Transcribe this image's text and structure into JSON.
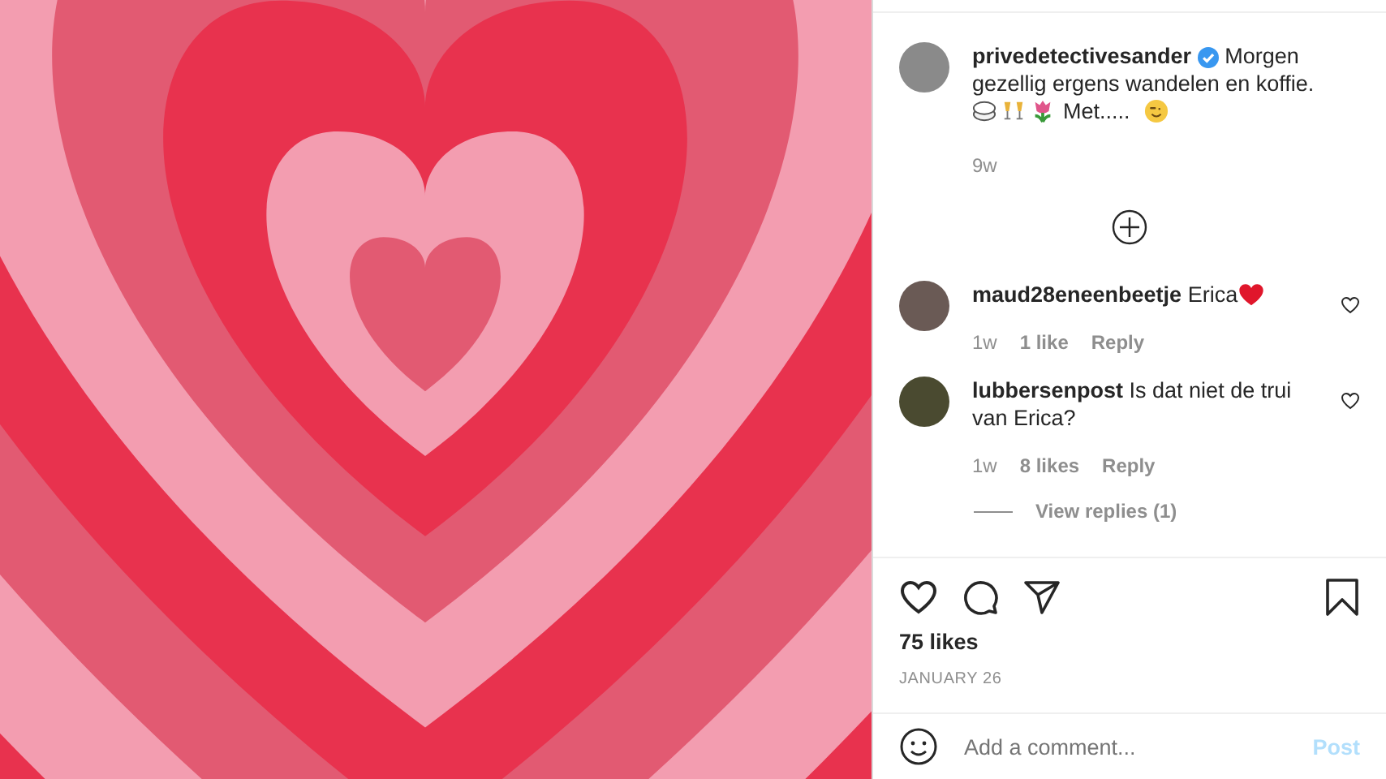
{
  "post": {
    "username": "privedetectivesander",
    "verified": true,
    "caption": "Morgen gezellig ergens wandelen en koffie.",
    "caption_more": "Met.....",
    "time": "9w"
  },
  "comments": [
    {
      "username": "maud28eneenbeetje",
      "text": "Erica",
      "time": "1w",
      "likes": "1 like",
      "reply": "Reply",
      "liked": false,
      "heart_after": true
    },
    {
      "username": "lubbersenpost",
      "text": "Is dat niet de trui van Erica?",
      "time": "1w",
      "likes": "8 likes",
      "reply": "Reply",
      "liked": false,
      "heart_after": false,
      "view_replies": "View replies (1)"
    }
  ],
  "likes": "75 likes",
  "date": "JANUARY 26",
  "comment_box": {
    "placeholder": "Add a comment...",
    "post": "Post",
    "disabled": true
  }
}
